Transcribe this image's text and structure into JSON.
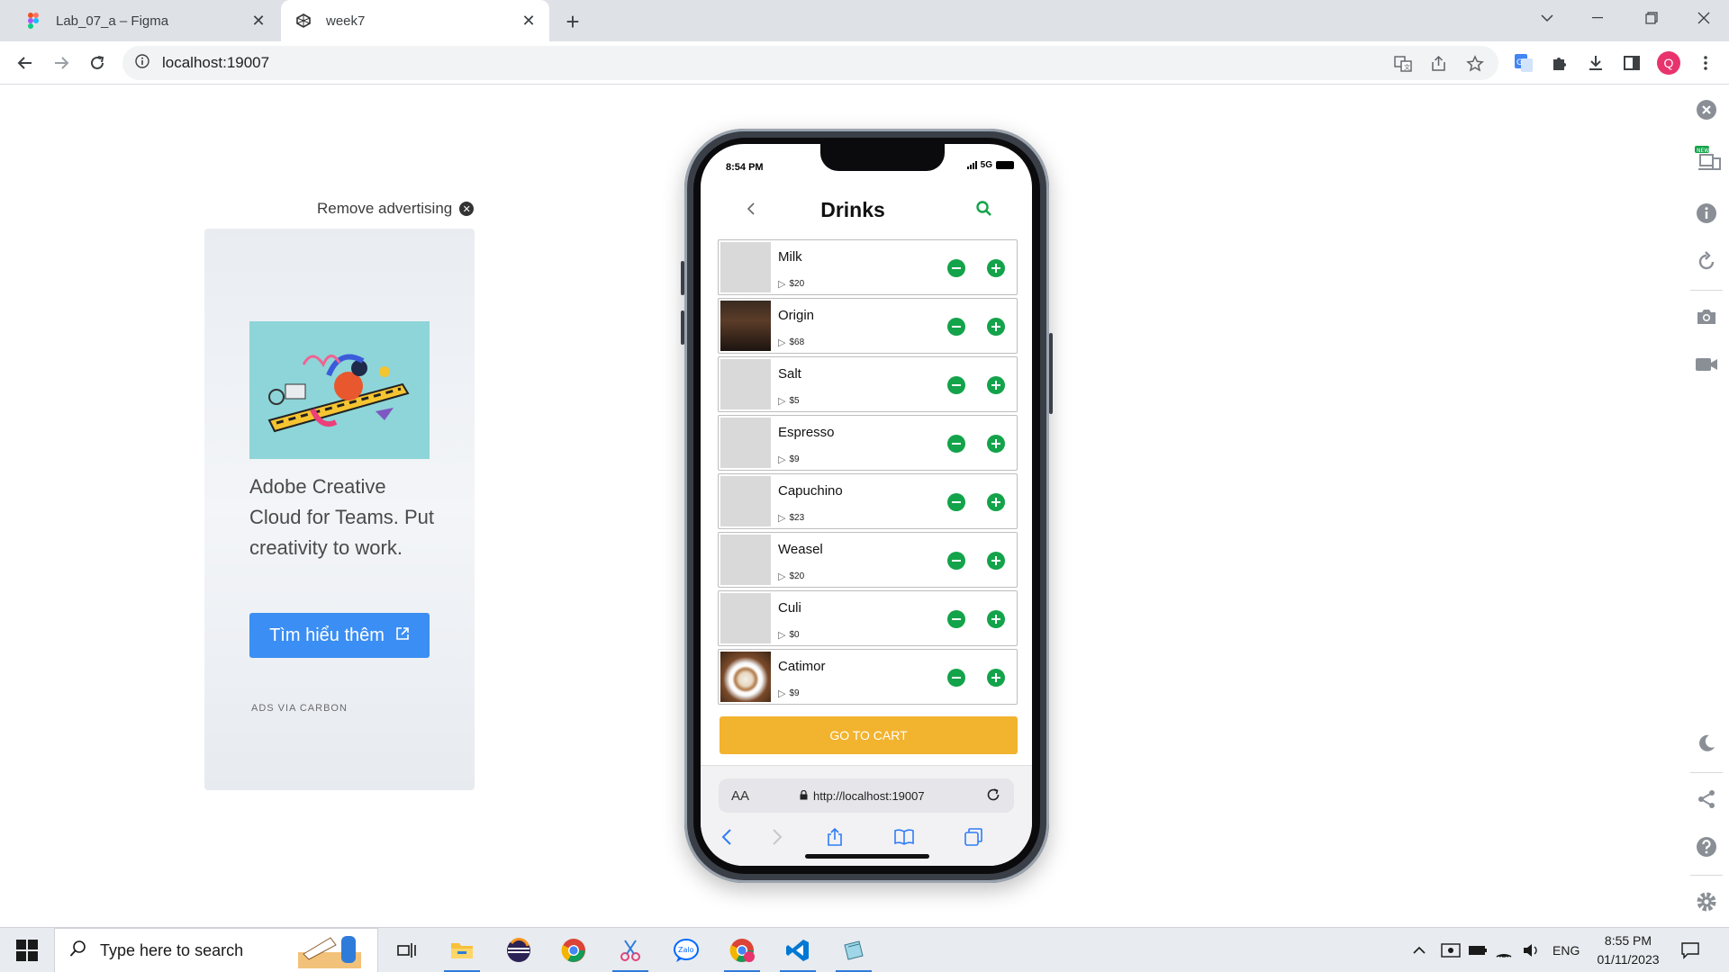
{
  "browser": {
    "tabs": [
      {
        "title": "Lab_07_a – Figma",
        "icon": "figma-icon",
        "active": false
      },
      {
        "title": "week7",
        "icon": "expo-icon",
        "active": true
      }
    ],
    "url": "localhost:19007",
    "profile_initial": "Q"
  },
  "ad": {
    "remove_label": "Remove advertising",
    "text": "Adobe Creative Cloud for Teams. Put creativity to work.",
    "cta": "Tìm hiểu thêm",
    "via": "ADS VIA CARBON"
  },
  "phone": {
    "status_time": "8:54 PM",
    "network": "5G",
    "title": "Drinks",
    "items": [
      {
        "name": "Milk",
        "price": "$20",
        "thumb": "placeholder"
      },
      {
        "name": "Origin",
        "price": "$68",
        "thumb": "coffee-photo"
      },
      {
        "name": "Salt",
        "price": "$5",
        "thumb": "placeholder"
      },
      {
        "name": "Espresso",
        "price": "$9",
        "thumb": "placeholder"
      },
      {
        "name": "Capuchino",
        "price": "$23",
        "thumb": "placeholder"
      },
      {
        "name": "Weasel",
        "price": "$20",
        "thumb": "placeholder"
      },
      {
        "name": "Culi",
        "price": "$0",
        "thumb": "placeholder"
      },
      {
        "name": "Catimor",
        "price": "$9",
        "thumb": "coffee-cup-photo"
      }
    ],
    "cart_button": "GO TO CART",
    "safari": {
      "aa": "AA",
      "url": "http://localhost:19007"
    }
  },
  "taskbar": {
    "search_placeholder": "Type here to search",
    "language": "ENG",
    "time": "8:55 PM",
    "date": "01/11/2023"
  },
  "colors": {
    "accent_green": "#13a34a",
    "cart_orange": "#f2b32f",
    "ad_button_blue": "#3b8ef3"
  }
}
